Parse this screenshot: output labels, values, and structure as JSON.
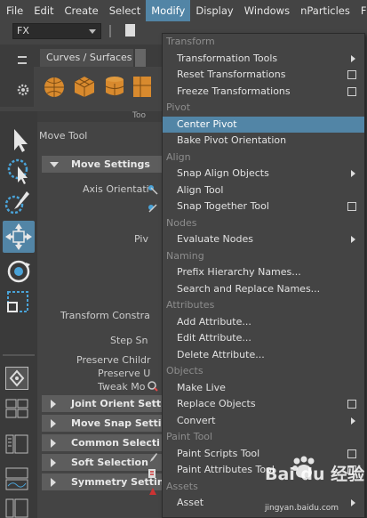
{
  "menubar": {
    "items": [
      "File",
      "Edit",
      "Create",
      "Select",
      "Modify",
      "Display",
      "Windows",
      "nParticles",
      "Flu"
    ],
    "active_index": 4
  },
  "statusline": {
    "mode": "FX"
  },
  "shelf": {
    "tab": "Curves / Surfaces"
  },
  "tool_settings": {
    "header": "Too",
    "tool_name": "Move Tool",
    "labels": {
      "axis_orientation": "Axis Orientati",
      "pivot": "Piv",
      "transform_constraint": "Transform Constra",
      "step_snap": "Step Sn",
      "preserve_children": "Preserve Childr",
      "preserve_uvs": "Preserve U",
      "tweak_mode": "Tweak Mo"
    },
    "sections": {
      "move_settings": "Move Settings",
      "joint_orient": "Joint Orient Sett",
      "move_snap": "Move Snap Setti",
      "common_selection": "Common Selecti",
      "soft_selection": "Soft Selection",
      "symmetry": "Symmetry Settin"
    }
  },
  "menu": {
    "rows": [
      {
        "type": "header",
        "label": "Transform"
      },
      {
        "type": "item",
        "label": "Transformation Tools",
        "submenu": true
      },
      {
        "type": "item",
        "label": "Reset Transformations",
        "option": true
      },
      {
        "type": "item",
        "label": "Freeze Transformations",
        "option": true
      },
      {
        "type": "header",
        "label": "Pivot"
      },
      {
        "type": "item",
        "label": "Center Pivot",
        "highlight": true
      },
      {
        "type": "item",
        "label": "Bake Pivot Orientation"
      },
      {
        "type": "header",
        "label": "Align"
      },
      {
        "type": "item",
        "label": "Snap Align Objects",
        "submenu": true
      },
      {
        "type": "item",
        "label": "Align Tool"
      },
      {
        "type": "item",
        "label": "Snap Together Tool",
        "option": true
      },
      {
        "type": "header",
        "label": "Nodes"
      },
      {
        "type": "item",
        "label": "Evaluate Nodes",
        "submenu": true
      },
      {
        "type": "header",
        "label": "Naming"
      },
      {
        "type": "item",
        "label": "Prefix Hierarchy Names..."
      },
      {
        "type": "item",
        "label": "Search and Replace Names..."
      },
      {
        "type": "header",
        "label": "Attributes"
      },
      {
        "type": "item",
        "label": "Add Attribute..."
      },
      {
        "type": "item",
        "label": "Edit Attribute..."
      },
      {
        "type": "item",
        "label": "Delete Attribute..."
      },
      {
        "type": "header",
        "label": "Objects"
      },
      {
        "type": "item",
        "label": "Make Live"
      },
      {
        "type": "item",
        "label": "Replace Objects",
        "option": true
      },
      {
        "type": "item",
        "label": "Convert",
        "submenu": true
      },
      {
        "type": "header",
        "label": "Paint Tool"
      },
      {
        "type": "item",
        "label": "Paint Scripts Tool",
        "option": true
      },
      {
        "type": "item",
        "label": "Paint Attributes Tool",
        "option": true
      },
      {
        "type": "header",
        "label": "Assets"
      },
      {
        "type": "item",
        "label": "Asset",
        "submenu": true
      }
    ]
  },
  "watermark": {
    "brand": "Bai du 经验",
    "url": "jingyan.baidu.com"
  },
  "colors": {
    "accent": "#5285a6",
    "background": "#444444",
    "section": "#5d5d5d"
  }
}
